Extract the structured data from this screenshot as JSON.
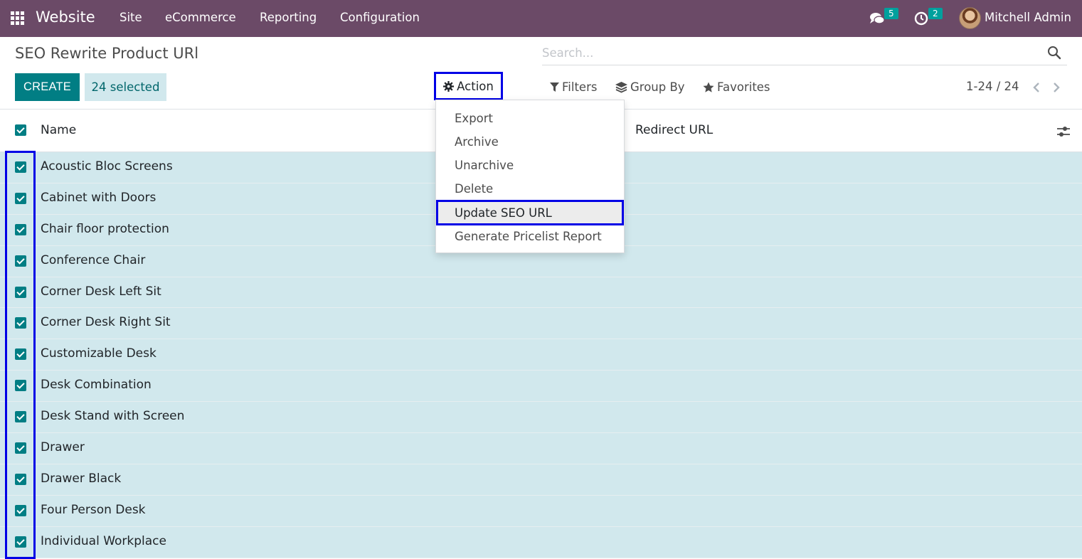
{
  "navbar": {
    "brand": "Website",
    "menus": [
      "Site",
      "eCommerce",
      "Reporting",
      "Configuration"
    ],
    "messages_count": "5",
    "activities_count": "2",
    "user_name": "Mitchell Admin",
    "bg_color": "#6b4a67"
  },
  "control_panel": {
    "title": "SEO Rewrite Product URl",
    "create_label": "CREATE",
    "selected_label": "24 selected",
    "action_label": "Action",
    "search_placeholder": "Search...",
    "filters_label": "Filters",
    "group_by_label": "Group By",
    "favorites_label": "Favorites",
    "pager": "1-24 / 24"
  },
  "action_menu": {
    "items": [
      "Export",
      "Archive",
      "Unarchive",
      "Delete",
      "Update SEO URL",
      "Generate Pricelist Report"
    ],
    "highlighted": "Update SEO URL"
  },
  "table": {
    "columns": [
      "Name",
      "Redirect URL"
    ],
    "rows": [
      "Acoustic Bloc Screens",
      "Cabinet with Doors",
      "Chair floor protection",
      "Conference Chair",
      "Corner Desk Left Sit",
      "Corner Desk Right Sit",
      "Customizable Desk",
      "Desk Combination",
      "Desk Stand with Screen",
      "Drawer",
      "Drawer Black",
      "Four Person Desk",
      "Individual Workplace"
    ]
  },
  "icons": {
    "apps": "apps-grid-icon",
    "messages": "chat-icon",
    "activities": "clock-icon",
    "action": "gear-icon",
    "search": "search-icon",
    "filters": "filter-icon",
    "group_by": "layers-icon",
    "favorites": "star-icon",
    "pager_prev": "chevron-left-icon",
    "pager_next": "chevron-right-icon",
    "column_settings": "sliders-icon"
  },
  "colors": {
    "primary": "#017e84",
    "selected_row": "#d1e8ed",
    "highlight_outline": "#0000e6"
  }
}
